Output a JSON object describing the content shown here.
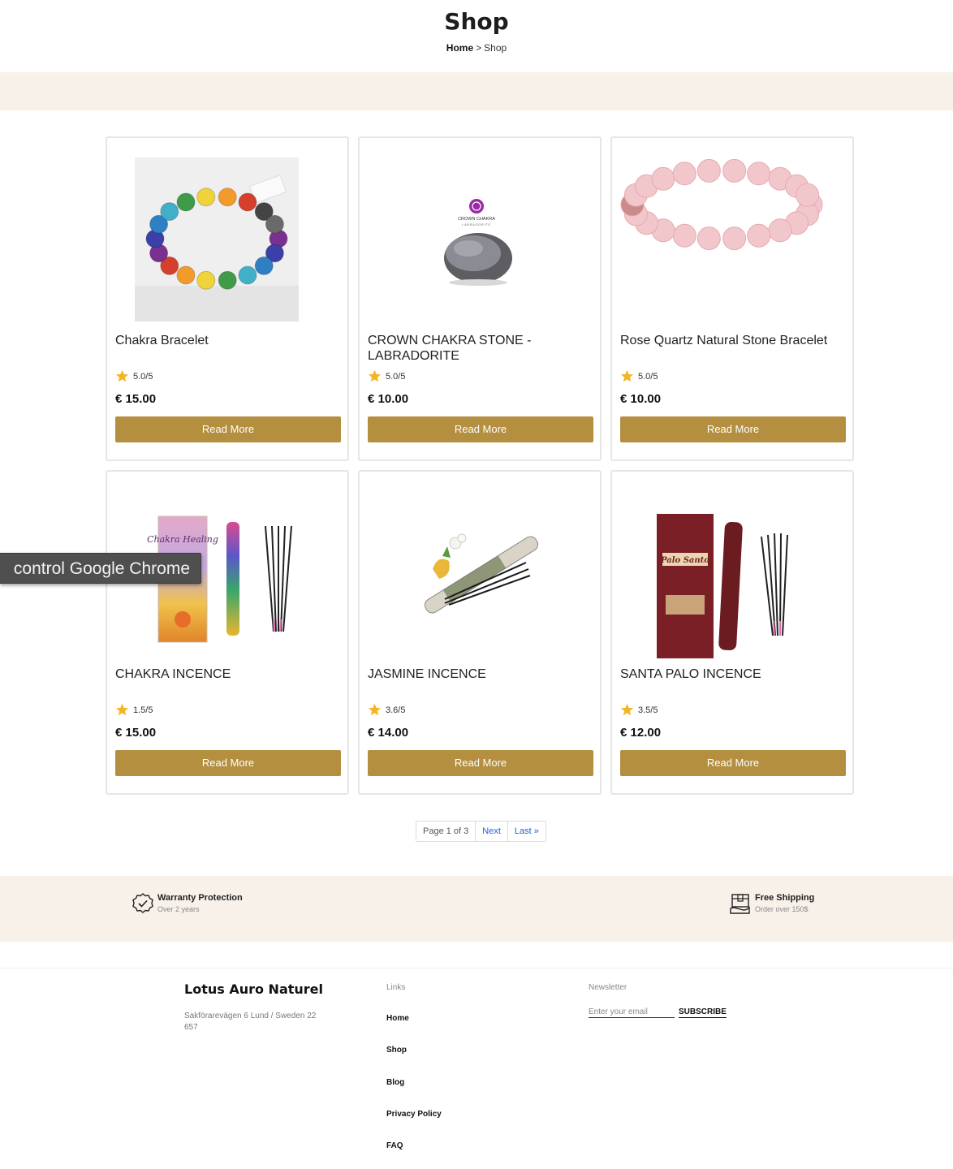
{
  "header": {
    "title": "Shop",
    "breadcrumb": {
      "home": "Home",
      "separator": ">",
      "current": "Shop"
    }
  },
  "products": [
    {
      "name": "Chakra Bracelet",
      "rating": "5.0/5",
      "price": "€ 15.00",
      "button": "Read More",
      "image": "chakra-bracelet-image"
    },
    {
      "name": "CROWN CHAKRA STONE - LABRADORITE",
      "rating": "5.0/5",
      "price": "€ 10.00",
      "button": "Read More",
      "image": "labradorite-stone-image",
      "image_label": "CROWN CHAKRA",
      "image_sublabel": "LABRADORITE"
    },
    {
      "name": "Rose Quartz Natural Stone Bracelet",
      "rating": "5.0/5",
      "price": "€ 10.00",
      "button": "Read More",
      "image": "rose-quartz-bracelet-image"
    },
    {
      "name": "CHAKRA INCENCE",
      "rating": "1.5/5",
      "price": "€ 15.00",
      "button": "Read More",
      "image": "chakra-incense-image",
      "image_label": "Chakra Healing"
    },
    {
      "name": "JASMINE INCENCE",
      "rating": "3.6/5",
      "price": "€ 14.00",
      "button": "Read More",
      "image": "jasmine-incense-image"
    },
    {
      "name": "SANTA PALO INCENCE",
      "rating": "3.5/5",
      "price": "€ 12.00",
      "button": "Read More",
      "image": "palo-santo-incense-image",
      "image_label": "Palo Santo"
    }
  ],
  "pagination": {
    "info": "Page 1 of 3",
    "next": "Next",
    "last": "Last »"
  },
  "features": [
    {
      "title": "Warranty Protection",
      "subtitle": "Over 2 years",
      "icon": "check-badge-icon"
    },
    {
      "title": "Free Shipping",
      "subtitle": "Order over 150$",
      "icon": "shipping-box-icon"
    }
  ],
  "footer": {
    "brand": "Lotus Auro Naturel",
    "address": "Sakförarevägen 6 Lund / Sweden 22 657",
    "links_title": "Links",
    "links": [
      "Home",
      "Shop",
      "Blog",
      "Privacy Policy",
      "FAQ"
    ],
    "newsletter_title": "Newsletter",
    "newsletter_placeholder": "Enter your email",
    "subscribe_label": "SUBSCRIBE"
  },
  "overlay": {
    "tooltip": "control Google Chrome"
  },
  "colors": {
    "accent": "#b38f3f",
    "band": "#f8f1ea",
    "star": "#f4b525",
    "link": "#1a64d6"
  }
}
